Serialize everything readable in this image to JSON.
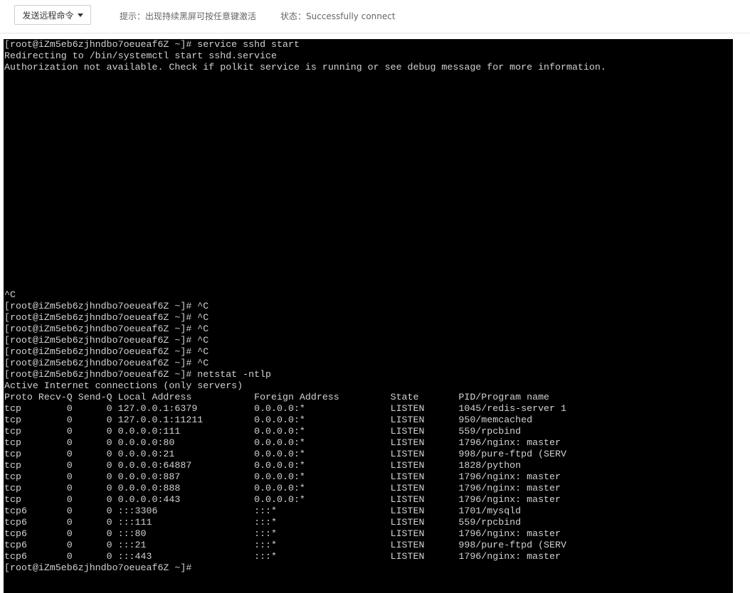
{
  "toolbar": {
    "send_command_label": "发送远程命令",
    "hint": "提示：出现持续黑屏可按任意键激活",
    "status": "状态：Successfully connect"
  },
  "terminal": {
    "top_lines": [
      "[root@iZm5eb6zjhndbo7oeueaf6Z ~]# service sshd start",
      "Redirecting to /bin/systemctl start sshd.service",
      "Authorization not available. Check if polkit service is running or see debug message for more information."
    ],
    "bottom_lines": [
      "^C",
      "[root@iZm5eb6zjhndbo7oeueaf6Z ~]# ^C",
      "[root@iZm5eb6zjhndbo7oeueaf6Z ~]# ^C",
      "[root@iZm5eb6zjhndbo7oeueaf6Z ~]# ^C",
      "[root@iZm5eb6zjhndbo7oeueaf6Z ~]# ^C",
      "[root@iZm5eb6zjhndbo7oeueaf6Z ~]# ^C",
      "[root@iZm5eb6zjhndbo7oeueaf6Z ~]# ^C",
      "[root@iZm5eb6zjhndbo7oeueaf6Z ~]# netstat -ntlp",
      "Active Internet connections (only servers)",
      "Proto Recv-Q Send-Q Local Address           Foreign Address         State       PID/Program name",
      "tcp        0      0 127.0.0.1:6379          0.0.0.0:*               LISTEN      1045/redis-server 1",
      "tcp        0      0 127.0.0.1:11211         0.0.0.0:*               LISTEN      950/memcached",
      "tcp        0      0 0.0.0.0:111             0.0.0.0:*               LISTEN      559/rpcbind",
      "tcp        0      0 0.0.0.0:80              0.0.0.0:*               LISTEN      1796/nginx: master",
      "tcp        0      0 0.0.0.0:21              0.0.0.0:*               LISTEN      998/pure-ftpd (SERV",
      "tcp        0      0 0.0.0.0:64887           0.0.0.0:*               LISTEN      1828/python",
      "tcp        0      0 0.0.0.0:887             0.0.0.0:*               LISTEN      1796/nginx: master",
      "tcp        0      0 0.0.0.0:888             0.0.0.0:*               LISTEN      1796/nginx: master",
      "tcp        0      0 0.0.0.0:443             0.0.0.0:*               LISTEN      1796/nginx: master",
      "tcp6       0      0 :::3306                 :::*                    LISTEN      1701/mysqld",
      "tcp6       0      0 :::111                  :::*                    LISTEN      559/rpcbind",
      "tcp6       0      0 :::80                   :::*                    LISTEN      1796/nginx: master",
      "tcp6       0      0 :::21                   :::*                    LISTEN      998/pure-ftpd (SERV",
      "tcp6       0      0 :::443                  :::*                    LISTEN      1796/nginx: master",
      "[root@iZm5eb6zjhndbo7oeueaf6Z ~]#"
    ]
  }
}
